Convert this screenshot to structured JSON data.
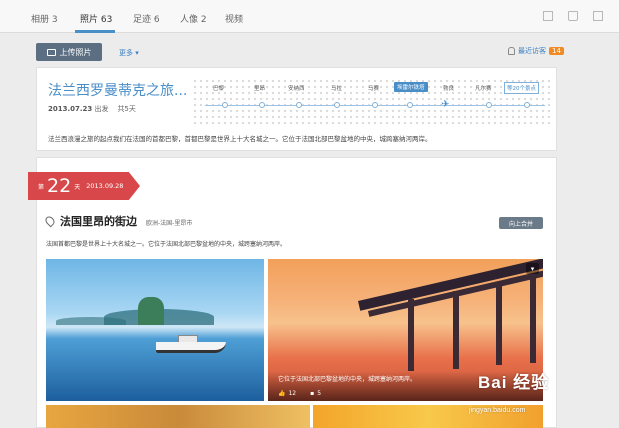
{
  "tabs": [
    {
      "label": "相册 3"
    },
    {
      "label": "照片 63"
    },
    {
      "label": "足迹 6"
    },
    {
      "label": "人像 2"
    },
    {
      "label": "视频"
    }
  ],
  "toolbar": {
    "upload_label": "上传照片",
    "more_label": "更多 ▾",
    "visitors_label": "最近访客",
    "visitors_count": "14"
  },
  "trip": {
    "title": "法兰西罗曼蒂克之旅...",
    "date": "2013.07.23",
    "depart": "出发",
    "duration": "共5天",
    "description": "法兰西浪漫之旅的起点我们在法国的首都巴黎，首都巴黎是世界上十大名城之一。它位于法国北部巴黎盆地的中央，城跨塞纳河两岸。",
    "stops": [
      "巴黎",
      "里昂",
      "安纳西",
      "马拉",
      "马赛",
      "埃雷尔铁塔",
      "勃良",
      "凡尔赛"
    ],
    "more_stops": "等20个景点"
  },
  "day": {
    "prefix": "第",
    "number": "22",
    "suffix": "天",
    "date": "2013.09.28",
    "place_title": "法国里昂的街边",
    "place_location": "欧洲-法国-里昂市",
    "append_label": "向上合并",
    "place_description": "法国首都巴黎是世界上十大名城之一。它位于法国北部巴黎盆地的中央，城跨塞纳河两岸。"
  },
  "photo2": {
    "caption": "它位于法国北部巴黎盆地的中央，城跨塞纳河两岸。",
    "likes": "12",
    "comments": "5"
  },
  "watermark": {
    "brand": "Bai 经验",
    "url": "jingyan.baidu.com"
  },
  "colors": {
    "accent": "#4a8ec8",
    "banner": "#d8484a",
    "badge": "#f08a24"
  }
}
